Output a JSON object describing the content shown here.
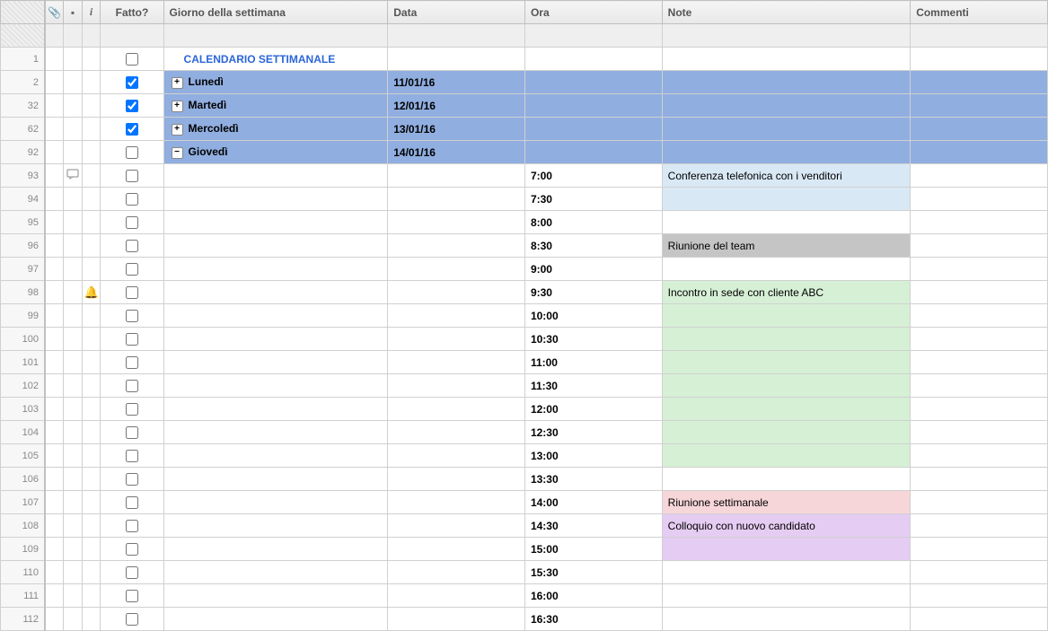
{
  "headers": {
    "attach": "",
    "comment": "",
    "info": "i",
    "fatto": "Fatto?",
    "giorno": "Giorno della settimana",
    "data": "Data",
    "ora": "Ora",
    "note": "Note",
    "commenti": "Commenti"
  },
  "title_row": {
    "num": "1",
    "label": "CALENDARIO SETTIMANALE"
  },
  "days": [
    {
      "num": "2",
      "checked": true,
      "expand": "+",
      "name": "Lunedì",
      "date": "11/01/16"
    },
    {
      "num": "32",
      "checked": true,
      "expand": "+",
      "name": "Martedì",
      "date": "12/01/16"
    },
    {
      "num": "62",
      "checked": true,
      "expand": "+",
      "name": "Mercoledì",
      "date": "13/01/16"
    },
    {
      "num": "92",
      "checked": false,
      "expand": "−",
      "name": "Giovedì",
      "date": "14/01/16"
    }
  ],
  "slots": [
    {
      "num": "93",
      "icon": "comment",
      "time": "7:00",
      "note": "Conferenza telefonica con i venditori",
      "note_bg": "bg-blue"
    },
    {
      "num": "94",
      "time": "7:30",
      "note": "",
      "note_bg": "bg-blue"
    },
    {
      "num": "95",
      "time": "8:00",
      "note": ""
    },
    {
      "num": "96",
      "time": "8:30",
      "note": "Riunione del team",
      "note_bg": "bg-grey"
    },
    {
      "num": "97",
      "time": "9:00",
      "note": ""
    },
    {
      "num": "98",
      "icon": "bell",
      "time": "9:30",
      "note": "Incontro in sede con cliente ABC",
      "note_bg": "bg-green"
    },
    {
      "num": "99",
      "time": "10:00",
      "note": "",
      "note_bg": "bg-green"
    },
    {
      "num": "100",
      "time": "10:30",
      "note": "",
      "note_bg": "bg-green"
    },
    {
      "num": "101",
      "time": "11:00",
      "note": "",
      "note_bg": "bg-green"
    },
    {
      "num": "102",
      "time": "11:30",
      "note": "",
      "note_bg": "bg-green"
    },
    {
      "num": "103",
      "time": "12:00",
      "note": "",
      "note_bg": "bg-green"
    },
    {
      "num": "104",
      "time": "12:30",
      "note": "",
      "note_bg": "bg-green"
    },
    {
      "num": "105",
      "time": "13:00",
      "note": "",
      "note_bg": "bg-green"
    },
    {
      "num": "106",
      "time": "13:30",
      "note": ""
    },
    {
      "num": "107",
      "time": "14:00",
      "note": "Riunione settimanale",
      "note_bg": "bg-pink"
    },
    {
      "num": "108",
      "time": "14:30",
      "note": "Colloquio con nuovo candidato",
      "note_bg": "bg-purple"
    },
    {
      "num": "109",
      "time": "15:00",
      "note": "",
      "note_bg": "bg-purple"
    },
    {
      "num": "110",
      "time": "15:30",
      "note": ""
    },
    {
      "num": "111",
      "time": "16:00",
      "note": ""
    },
    {
      "num": "112",
      "time": "16:30",
      "note": ""
    }
  ],
  "icons": {
    "attachment": "📎",
    "comment_hdr": "▪",
    "info": "i",
    "comment_bubble": "💬",
    "bell": "🔔"
  }
}
